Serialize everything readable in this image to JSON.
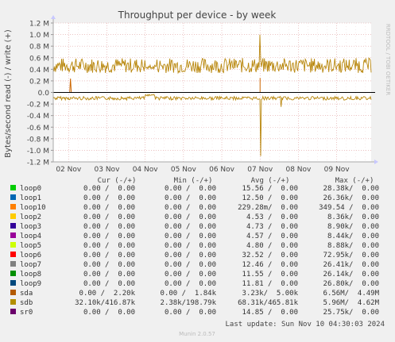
{
  "chart_data": {
    "type": "line",
    "title": "Throughput per device - by week",
    "ylabel": "Bytes/second read (-) / write (+)",
    "side_label": "RRDTOOL / TOBI OETIKER",
    "ylim": [
      -1200000,
      1200000
    ],
    "y_ticks": [
      {
        "v": 1200000,
        "label": "1.2 M"
      },
      {
        "v": 1000000,
        "label": "1.0 M"
      },
      {
        "v": 800000,
        "label": "0.8 M"
      },
      {
        "v": 600000,
        "label": "0.6 M"
      },
      {
        "v": 400000,
        "label": "0.4 M"
      },
      {
        "v": 200000,
        "label": "0.2 M"
      },
      {
        "v": 0,
        "label": "0.0"
      },
      {
        "v": -200000,
        "label": "-0.2 M"
      },
      {
        "v": -400000,
        "label": "-0.4 M"
      },
      {
        "v": -600000,
        "label": "-0.6 M"
      },
      {
        "v": -800000,
        "label": "-0.8 M"
      },
      {
        "v": -1000000,
        "label": "-1.0 M"
      },
      {
        "v": -1200000,
        "label": "-1.2 M"
      }
    ],
    "x_range_days": [
      1.6,
      9.9
    ],
    "x_ticks": [
      {
        "day": 2,
        "label": "02 Nov"
      },
      {
        "day": 3,
        "label": "03 Nov"
      },
      {
        "day": 4,
        "label": "04 Nov"
      },
      {
        "day": 5,
        "label": "05 Nov"
      },
      {
        "day": 6,
        "label": "06 Nov"
      },
      {
        "day": 7,
        "label": "07 Nov"
      },
      {
        "day": 8,
        "label": "08 Nov"
      },
      {
        "day": 9,
        "label": "09 Nov"
      }
    ],
    "grid": true,
    "series": [
      {
        "name": "sdb",
        "color": "#B8860B",
        "write_avg": 465810,
        "write_max": 4620000,
        "read_avg": 68310,
        "read_max": 5960000
      },
      {
        "name": "sda",
        "color": "#CC6600",
        "write_avg": 5000,
        "write_max": 4490000,
        "read_avg": 3230,
        "read_max": 6560000
      }
    ]
  },
  "legend": {
    "headers": {
      "cur": "Cur (-/+)",
      "min": "Min (-/+)",
      "avg": "Avg (-/+)",
      "max": "Max (-/+)"
    },
    "rows": [
      {
        "name": "loop0",
        "color": "#00CC00",
        "cur": "0.00 /  0.00",
        "min": "0.00 /  0.00",
        "avg": "15.56 /  0.00",
        "max": "28.38k/  0.00"
      },
      {
        "name": "loop1",
        "color": "#0066B3",
        "cur": "0.00 /  0.00",
        "min": "0.00 /  0.00",
        "avg": "12.50 /  0.00",
        "max": "26.36k/  0.00"
      },
      {
        "name": "loop10",
        "color": "#FF8000",
        "cur": "0.00 /  0.00",
        "min": "0.00 /  0.00",
        "avg": "229.28m/  0.00",
        "max": "349.54 /  0.00"
      },
      {
        "name": "loop2",
        "color": "#FFCC00",
        "cur": "0.00 /  0.00",
        "min": "0.00 /  0.00",
        "avg": "4.53 /  0.00",
        "max": "8.36k/  0.00"
      },
      {
        "name": "loop3",
        "color": "#330099",
        "cur": "0.00 /  0.00",
        "min": "0.00 /  0.00",
        "avg": "4.73 /  0.00",
        "max": "8.90k/  0.00"
      },
      {
        "name": "loop4",
        "color": "#990099",
        "cur": "0.00 /  0.00",
        "min": "0.00 /  0.00",
        "avg": "4.57 /  0.00",
        "max": "8.44k/  0.00"
      },
      {
        "name": "loop5",
        "color": "#CCFF00",
        "cur": "0.00 /  0.00",
        "min": "0.00 /  0.00",
        "avg": "4.80 /  0.00",
        "max": "8.88k/  0.00"
      },
      {
        "name": "loop6",
        "color": "#FF0000",
        "cur": "0.00 /  0.00",
        "min": "0.00 /  0.00",
        "avg": "32.52 /  0.00",
        "max": "72.95k/  0.00"
      },
      {
        "name": "loop7",
        "color": "#808080",
        "cur": "0.00 /  0.00",
        "min": "0.00 /  0.00",
        "avg": "12.46 /  0.00",
        "max": "26.41k/  0.00"
      },
      {
        "name": "loop8",
        "color": "#008F00",
        "cur": "0.00 /  0.00",
        "min": "0.00 /  0.00",
        "avg": "11.55 /  0.00",
        "max": "26.14k/  0.00"
      },
      {
        "name": "loop9",
        "color": "#00487D",
        "cur": "0.00 /  0.00",
        "min": "0.00 /  0.00",
        "avg": "11.81 /  0.00",
        "max": "26.80k/  0.00"
      },
      {
        "name": "sda",
        "color": "#B35A00",
        "cur": "0.00 /  2.20k",
        "min": "0.00 /  1.84k",
        "avg": "3.23k/  5.00k",
        "max": "6.56M/  4.49M"
      },
      {
        "name": "sdb",
        "color": "#B38F00",
        "cur": "32.10k/416.87k",
        "min": "2.38k/198.79k",
        "avg": "68.31k/465.81k",
        "max": "5.96M/  4.62M"
      },
      {
        "name": "sr0",
        "color": "#6B006B",
        "cur": "0.00 /  0.00",
        "min": "0.00 /  0.00",
        "avg": "14.85 /  0.00",
        "max": "25.75k/  0.00"
      }
    ]
  },
  "last_update": "Last update: Sun Nov 10 04:30:03 2024",
  "footer": "Munin 2.0.57"
}
